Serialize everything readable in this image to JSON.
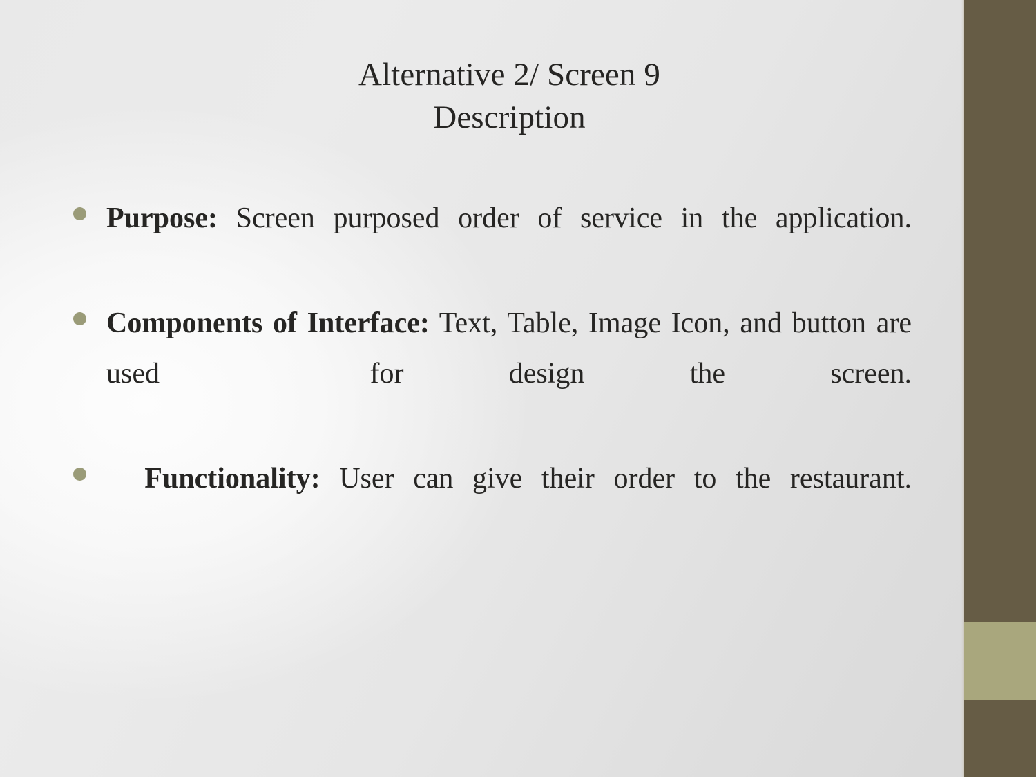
{
  "slide": {
    "title_lines": [
      "Alternative 2/ Screen 9",
      "Description"
    ],
    "bullets": [
      {
        "lead": "Purpose:",
        "rest": " Screen purposed order of service in the application."
      },
      {
        "lead": "Components of Interface:",
        "rest": " Text, Table, Image Icon, and button are used  for design the screen."
      },
      {
        "lead": "  Functionality:",
        "rest": " User can give their order to the restaurant."
      }
    ]
  },
  "theme": {
    "bullet_color": "#9a9b78",
    "text_color": "#262523",
    "rail_dark": "#665c45",
    "rail_light": "#a9a77d",
    "background_light": "#fdfdfd",
    "background_dark": "#d8d8d8"
  }
}
